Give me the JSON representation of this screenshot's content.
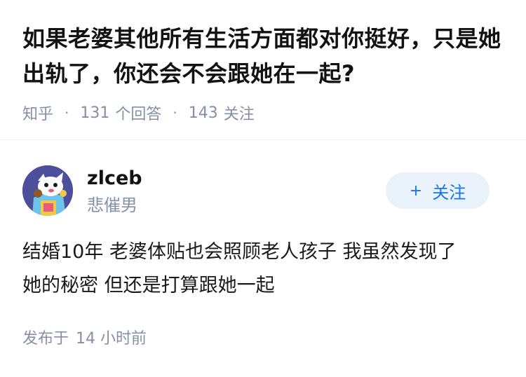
{
  "question": {
    "title": "如果老婆其他所有生活方面都对你挺好，只是她出轨了，你还会不会跟她在一起?",
    "source": "知乎",
    "answers_count": "131",
    "answers_label": "个回答",
    "followers_count": "143",
    "followers_label": "关注"
  },
  "answer": {
    "author": {
      "name": "zlceb",
      "tagline": "悲催男",
      "avatar_icon": "cartoon-animal-avatar"
    },
    "follow_button": {
      "plus": "+",
      "label": "关注"
    },
    "content": [
      "结婚10年 老婆体贴也会照顾老人孩子 我虽然发现了",
      "她的秘密 但还是打算跟她一起"
    ],
    "published_label": "发布于",
    "published_time": "14 小时前"
  },
  "colors": {
    "meta_gray": "#8590a6",
    "accent_blue": "#1772f6",
    "button_bg": "#eaf2fb"
  }
}
